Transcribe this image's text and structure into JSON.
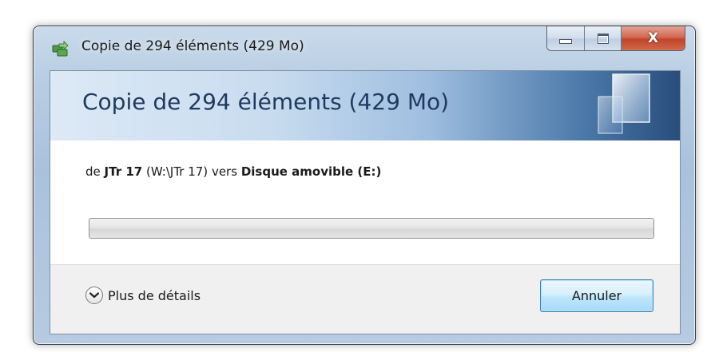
{
  "window": {
    "title": "Copie de 294 éléments (429 Mo)",
    "app_icon": "copy-files-icon",
    "caption_buttons": {
      "minimize_icon": "minimize-icon",
      "maximize_icon": "maximize-icon",
      "close_icon": "close-icon",
      "close_glyph": "X"
    }
  },
  "banner": {
    "heading": "Copie de 294 éléments (429 Mo)",
    "decoration_icon": "glass-panes-icon"
  },
  "copy_info": {
    "prefix": "de",
    "source_name": "JTr 17",
    "source_path": "(W:\\JTr 17)",
    "connector": "vers",
    "destination_name": "Disque amovible (E:)"
  },
  "progress": {
    "percent": 0
  },
  "footer": {
    "details_label": "Plus de détails",
    "details_icon": "chevron-down-icon",
    "cancel_label": "Annuler"
  },
  "colors": {
    "banner_text": "#1e3a5f",
    "close_button": "#c0442a",
    "progress_green": "#37b532",
    "default_button_border": "#3c7fb1"
  }
}
